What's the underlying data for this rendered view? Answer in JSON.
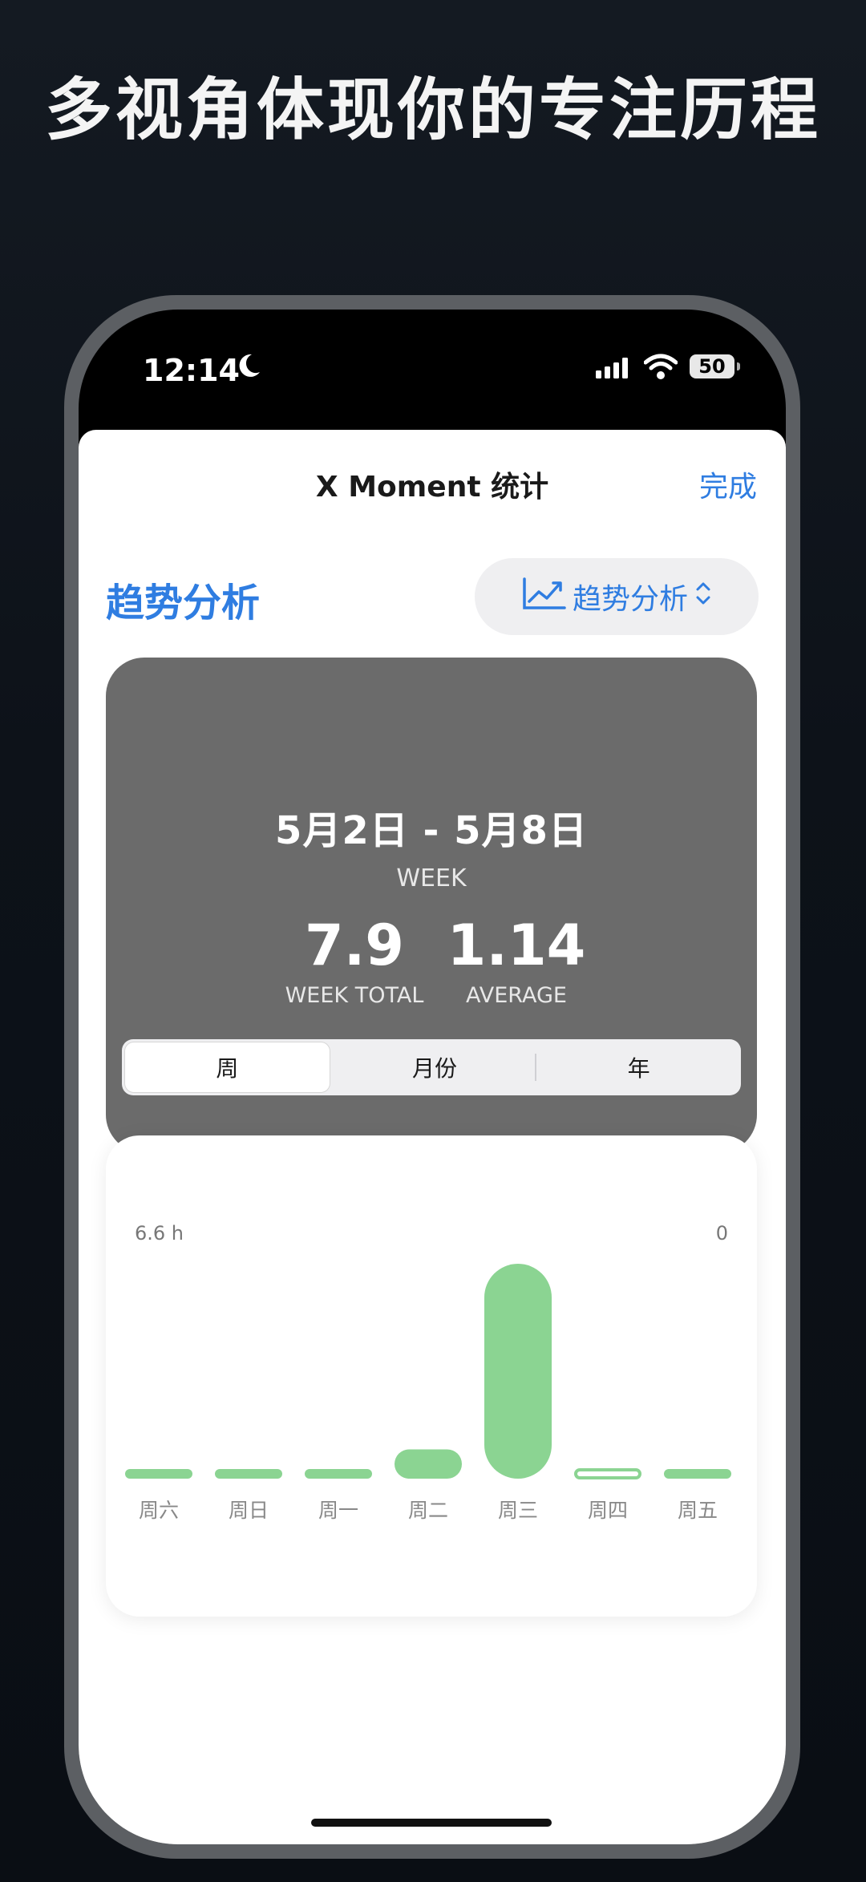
{
  "headline": "多视角体现你的专注历程",
  "status": {
    "time": "12:14",
    "battery": "50"
  },
  "nav": {
    "title": "X Moment 统计",
    "done": "完成"
  },
  "section": {
    "title": "趋势分析",
    "picker_label": "趋势分析"
  },
  "summary": {
    "date_range": "5月2日 - 5月8日",
    "period": "WEEK",
    "total": "7.9",
    "total_label": "WEEK TOTAL",
    "average": "1.14",
    "average_label": "AVERAGE"
  },
  "segments": [
    "周",
    "月份",
    "年"
  ],
  "colors": {
    "accent": "#2f7de1",
    "bar": "#8bd492",
    "card": "#6b6b6b"
  },
  "chart_data": {
    "type": "bar",
    "categories": [
      "周六",
      "周日",
      "周一",
      "周二",
      "周三",
      "周四",
      "周五"
    ],
    "values": [
      0,
      0,
      0,
      0.9,
      6.6,
      0.03,
      0
    ],
    "y_max_label": "6.6 h",
    "y_right_label": "0",
    "ylim": [
      0,
      6.6
    ]
  }
}
